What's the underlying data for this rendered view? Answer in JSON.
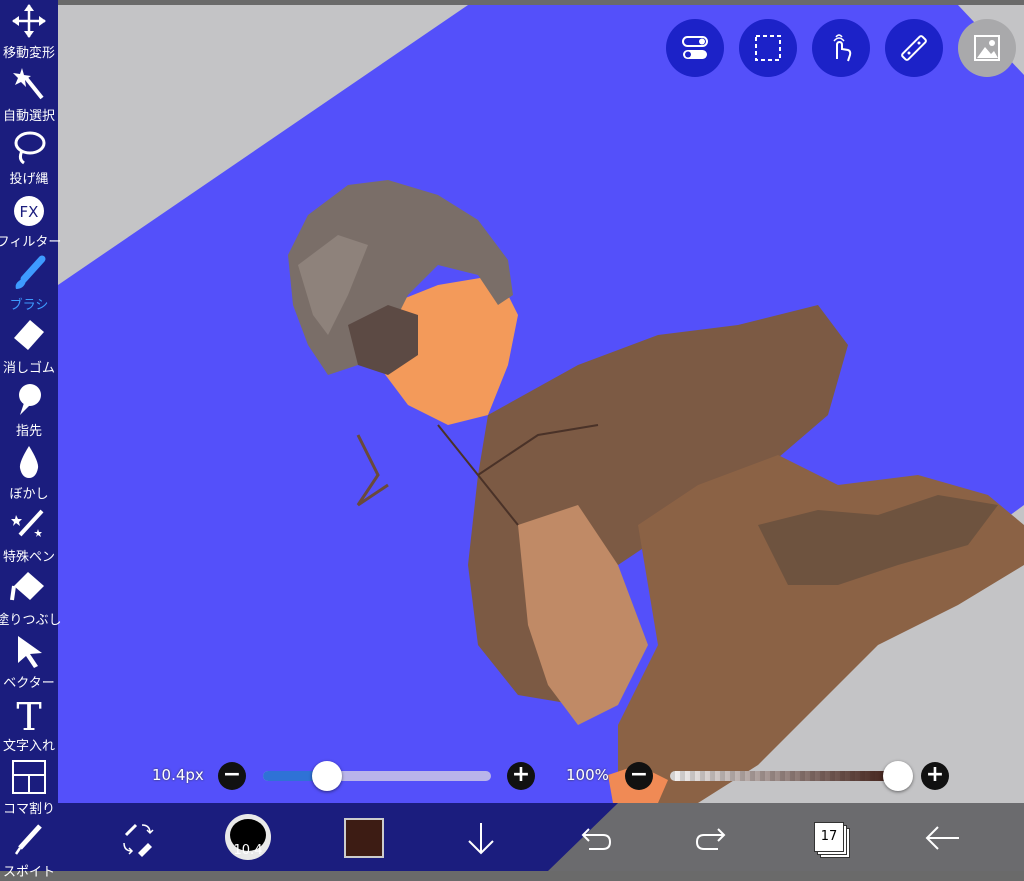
{
  "tools": [
    {
      "id": "move",
      "label": "移動変形",
      "icon": "move-arrows-icon",
      "active": false
    },
    {
      "id": "magic",
      "label": "自動選択",
      "icon": "magic-wand-icon",
      "active": false
    },
    {
      "id": "lasso",
      "label": "投げ縄",
      "icon": "lasso-icon",
      "active": false
    },
    {
      "id": "filter",
      "label": "フィルター",
      "icon": "fx-icon",
      "active": false
    },
    {
      "id": "brush",
      "label": "ブラシ",
      "icon": "brush-icon",
      "active": true
    },
    {
      "id": "eraser",
      "label": "消しゴム",
      "icon": "eraser-icon",
      "active": false
    },
    {
      "id": "finger",
      "label": "指先",
      "icon": "finger-smudge-icon",
      "active": false
    },
    {
      "id": "blur",
      "label": "ぼかし",
      "icon": "blur-drop-icon",
      "active": false
    },
    {
      "id": "special",
      "label": "特殊ペン",
      "icon": "special-pen-icon",
      "active": false
    },
    {
      "id": "fill",
      "label": "塗りつぶし",
      "icon": "bucket-fill-icon",
      "active": false
    },
    {
      "id": "vector",
      "label": "ベクター",
      "icon": "vector-cursor-icon",
      "active": false
    },
    {
      "id": "text",
      "label": "文字入れ",
      "icon": "text-tool-icon",
      "active": false
    },
    {
      "id": "frame",
      "label": "コマ割り",
      "icon": "frame-divider-icon",
      "active": false
    },
    {
      "id": "eyedropper",
      "label": "スポイト",
      "icon": "eyedropper-icon",
      "active": false
    }
  ],
  "top_buttons": [
    "toggle-switches-icon",
    "selection-marquee-icon",
    "hand-gesture-icon",
    "ruler-icon",
    "layer-image-icon"
  ],
  "brush_size": {
    "label": "10.4px",
    "level_fraction": 0.28
  },
  "opacity": {
    "label": "100%",
    "level_fraction": 1.0
  },
  "bottom": {
    "brush_preview_value": "10.4",
    "current_color": "#3d1c14",
    "layers_count": "17"
  },
  "colors": {
    "ui_dark_blue": "#1b1d7e",
    "canvas_blue": "#5450fa",
    "accent_blue": "#3e9bff",
    "top_button_blue": "#1c22c8"
  }
}
